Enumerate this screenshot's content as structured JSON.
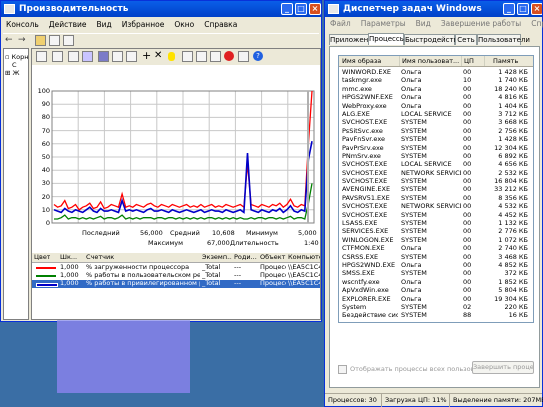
{
  "perf": {
    "title": "Производительность",
    "menu": [
      "Консоль",
      "Действие",
      "Вид",
      "Избранное",
      "Окно",
      "Справка"
    ],
    "tree": [
      "Корн",
      "С",
      "Ж"
    ],
    "y_ticks": [
      "100",
      "90",
      "80",
      "70",
      "60",
      "50",
      "40",
      "30",
      "20",
      "10",
      "0"
    ],
    "stats": {
      "last_label": "Последний",
      "last_value": "56,000",
      "avg_label": "Средний",
      "avg_value": "10,608",
      "min_label": "Минимум",
      "min_value": "5,000",
      "max_label": "Максимум",
      "max_value": "67,000",
      "dur_label": "Длительность",
      "dur_value": "1:40"
    },
    "legend_headers": [
      "Цвет",
      "Шк...",
      "Счетчик",
      "Экземп...",
      "Роди...",
      "Объект",
      "Компьютер"
    ],
    "legend_rows": [
      {
        "scale": "1,000",
        "counter": "% загруженности процессора",
        "instance": "_Total",
        "parent": "---",
        "object": "Процесс...",
        "computer": "\\\\EA5C1C4..."
      },
      {
        "scale": "1,000",
        "counter": "% работы в пользовательском режиме",
        "instance": "_Total",
        "parent": "---",
        "object": "Процесс...",
        "computer": "\\\\EA5C1C4..."
      },
      {
        "scale": "1,000",
        "counter": "% работы в привилегированном реж...",
        "instance": "_Total",
        "parent": "---",
        "object": "Процесс...",
        "computer": "\\\\EA5C1C4..."
      }
    ]
  },
  "taskmgr": {
    "title": "Диспетчер задач Windows",
    "menu": [
      "Файл",
      "Параметры",
      "Вид",
      "Завершение работы",
      "Справка"
    ],
    "tabs": [
      "Приложения",
      "Процессы",
      "Быстродействие",
      "Сеть",
      "Пользователи"
    ],
    "columns": [
      "Имя образа",
      "Имя пользоват...",
      "ЦП",
      "Память"
    ],
    "processes": [
      [
        "WINWORD.EXE",
        "Ольга",
        "00",
        "1 428 КБ"
      ],
      [
        "taskmgr.exe",
        "Ольга",
        "10",
        "1 740 КБ"
      ],
      [
        "mmc.exe",
        "Ольга",
        "00",
        "18 240 КБ"
      ],
      [
        "HPGS2WNF.EXE",
        "Ольга",
        "00",
        "4 816 КБ"
      ],
      [
        "WebProxy.exe",
        "Ольга",
        "00",
        "1 404 КБ"
      ],
      [
        "ALG.EXE",
        "LOCAL SERVICE",
        "00",
        "3 712 КБ"
      ],
      [
        "SVCHOST.EXE",
        "SYSTEM",
        "00",
        "3 668 КБ"
      ],
      [
        "PsSitSvc.exe",
        "SYSTEM",
        "00",
        "2 756 КБ"
      ],
      [
        "PavFnSvr.exe",
        "SYSTEM",
        "00",
        "1 428 КБ"
      ],
      [
        "PavPrSrv.exe",
        "SYSTEM",
        "00",
        "12 304 КБ"
      ],
      [
        "PNmSrv.exe",
        "SYSTEM",
        "00",
        "6 892 КБ"
      ],
      [
        "SVCHOST.EXE",
        "LOCAL SERVICE",
        "00",
        "4 656 КБ"
      ],
      [
        "SVCHOST.EXE",
        "NETWORK SERVICE",
        "00",
        "2 532 КБ"
      ],
      [
        "SVCHOST.EXE",
        "SYSTEM",
        "00",
        "16 804 КБ"
      ],
      [
        "AVENGINE.EXE",
        "SYSTEM",
        "00",
        "33 212 КБ"
      ],
      [
        "PAVSRV51.EXE",
        "SYSTEM",
        "00",
        "8 356 КБ"
      ],
      [
        "SVCHOST.EXE",
        "NETWORK SERVICE",
        "00",
        "4 532 КБ"
      ],
      [
        "SVCHOST.EXE",
        "SYSTEM",
        "00",
        "4 452 КБ"
      ],
      [
        "LSASS.EXE",
        "SYSTEM",
        "00",
        "1 132 КБ"
      ],
      [
        "SERVICES.EXE",
        "SYSTEM",
        "00",
        "2 776 КБ"
      ],
      [
        "WINLOGON.EXE",
        "SYSTEM",
        "00",
        "1 072 КБ"
      ],
      [
        "CTFMON.EXE",
        "Ольга",
        "00",
        "2 740 КБ"
      ],
      [
        "CSRSS.EXE",
        "SYSTEM",
        "00",
        "3 468 КБ"
      ],
      [
        "HPGS2WND.EXE",
        "Ольга",
        "00",
        "4 852 КБ"
      ],
      [
        "SMSS.EXE",
        "SYSTEM",
        "00",
        "372 КБ"
      ],
      [
        "wscntfy.exe",
        "Ольга",
        "00",
        "1 852 КБ"
      ],
      [
        "ApVxdWin.exe",
        "Ольга",
        "00",
        "5 804 КБ"
      ],
      [
        "EXPLORER.EXE",
        "Ольга",
        "00",
        "19 304 КБ"
      ],
      [
        "System",
        "SYSTEM",
        "02",
        "220 КБ"
      ],
      [
        "Бездействие сис...",
        "SYSTEM",
        "88",
        "16 КБ"
      ]
    ],
    "show_all_label": "Отображать процессы всех пользователей",
    "end_process_label": "Завершить процесс",
    "status": {
      "processes": "Процессов: 30",
      "cpu": "Загрузка ЦП: 11%",
      "memory": "Выделение памяти: 207МБ / 6"
    }
  },
  "chart_data": {
    "type": "line",
    "ylim": [
      0,
      100
    ],
    "series": [
      {
        "color": "#ff0000",
        "values": [
          14,
          12,
          13,
          17,
          11,
          12,
          14,
          10,
          12,
          13,
          15,
          11,
          12,
          16,
          11,
          12,
          14,
          13,
          12,
          22,
          12,
          13,
          12,
          14,
          13,
          12,
          14,
          15,
          13,
          12,
          14,
          13,
          12,
          14,
          13,
          12,
          13,
          14,
          12,
          13,
          12,
          14,
          12,
          13,
          14,
          12,
          13,
          12,
          14,
          13,
          12,
          13,
          14,
          12,
          45,
          14,
          13,
          12,
          14,
          13,
          12,
          14,
          13,
          15,
          12,
          14,
          18,
          13,
          12,
          14,
          13,
          60,
          100
        ]
      },
      {
        "color": "#0000c8",
        "values": [
          10,
          9,
          8,
          11,
          9,
          8,
          10,
          9,
          8,
          10,
          12,
          9,
          8,
          11,
          9,
          9,
          10,
          9,
          8,
          17,
          9,
          10,
          9,
          10,
          9,
          8,
          10,
          11,
          9,
          9,
          10,
          9,
          8,
          10,
          9,
          8,
          9,
          10,
          9,
          8,
          9,
          10,
          8,
          9,
          10,
          9,
          9,
          8,
          10,
          9,
          8,
          9,
          10,
          8,
          53,
          10,
          9,
          8,
          10,
          9,
          8,
          10,
          9,
          11,
          8,
          10,
          13,
          9,
          8,
          10,
          9,
          48,
          62
        ]
      },
      {
        "color": "#008000",
        "values": [
          3,
          3,
          4,
          6,
          3,
          4,
          4,
          3,
          4,
          3,
          4,
          3,
          4,
          5,
          3,
          4,
          4,
          3,
          4,
          6,
          3,
          4,
          3,
          4,
          3,
          4,
          4,
          4,
          3,
          4,
          4,
          3,
          4,
          4,
          3,
          4,
          3,
          4,
          3,
          4,
          3,
          4,
          3,
          4,
          4,
          3,
          4,
          3,
          4,
          3,
          4,
          3,
          4,
          3,
          3,
          4,
          3,
          4,
          4,
          3,
          4,
          4,
          3,
          4,
          3,
          4,
          5,
          3,
          4,
          4,
          3,
          15,
          30
        ]
      }
    ]
  }
}
